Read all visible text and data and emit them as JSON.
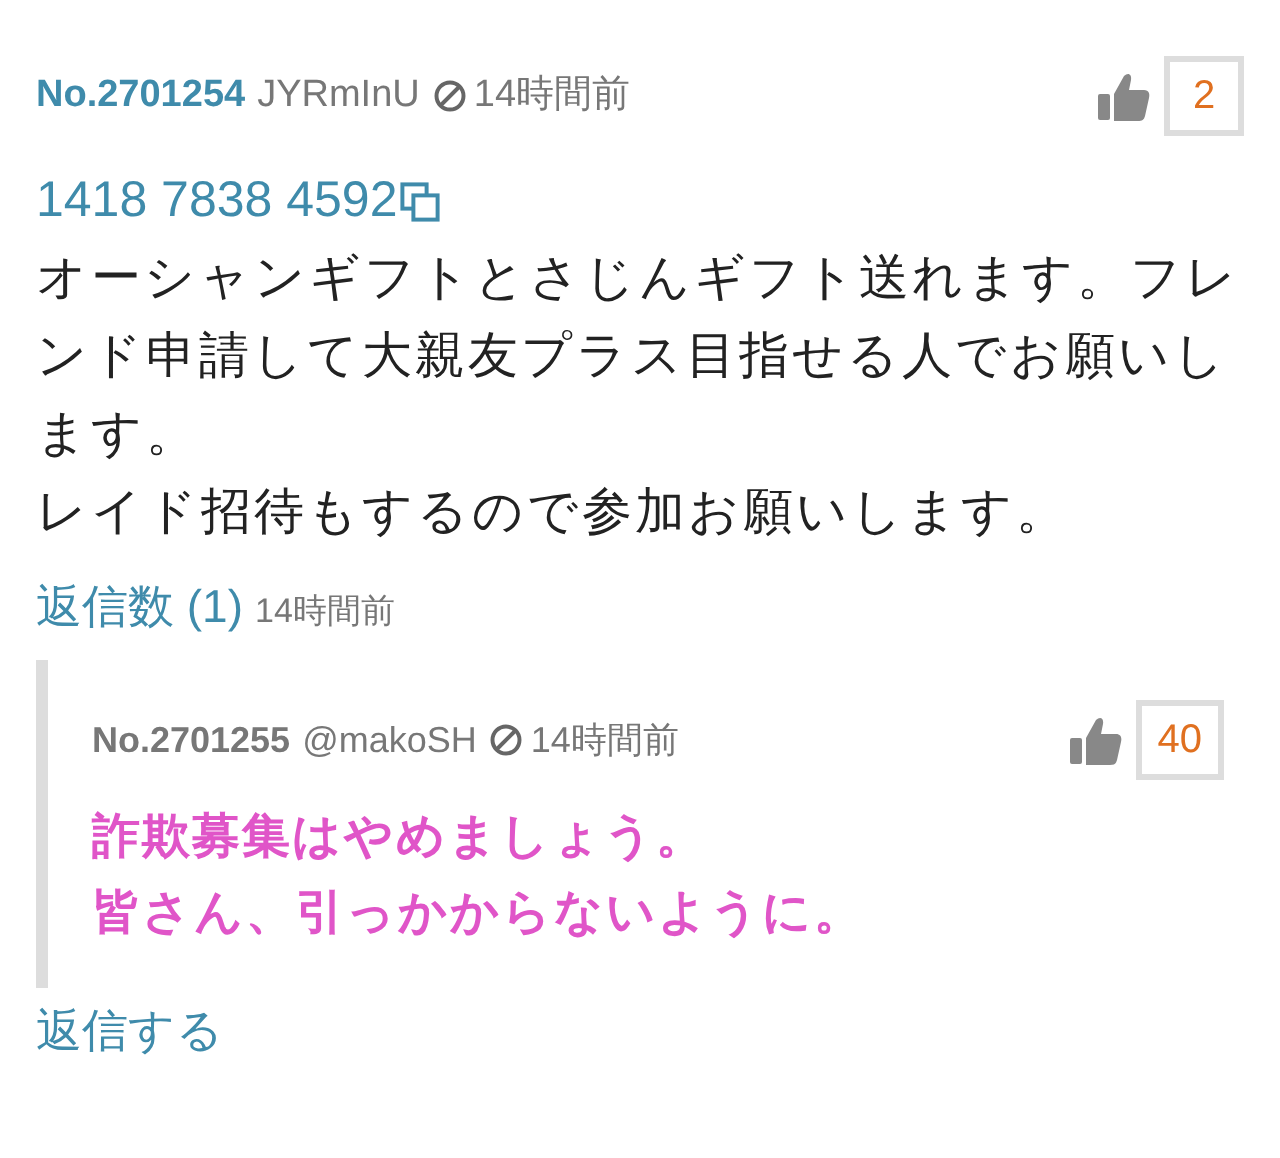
{
  "post": {
    "number": "No.2701254",
    "user": "JYRmInU",
    "time": "14時間前",
    "likes": "2",
    "friend_code": "1418 7838 4592",
    "paragraphs": [
      "オーシャンギフトとさじんギフト送れます。フレンド申請して大親友プラス目指せる人でお願いします。",
      "レイド招待もするので参加お願いします。"
    ],
    "replies_link": "返信数 (1)",
    "replies_time": "14時間前"
  },
  "replies": [
    {
      "number": "No.2701255",
      "user": "@makoSH",
      "time": "14時間前",
      "likes": "40",
      "lines": [
        "詐欺募集はやめましょう。",
        "皆さん、引っかからないように。"
      ]
    }
  ],
  "reply_button": "返信する"
}
